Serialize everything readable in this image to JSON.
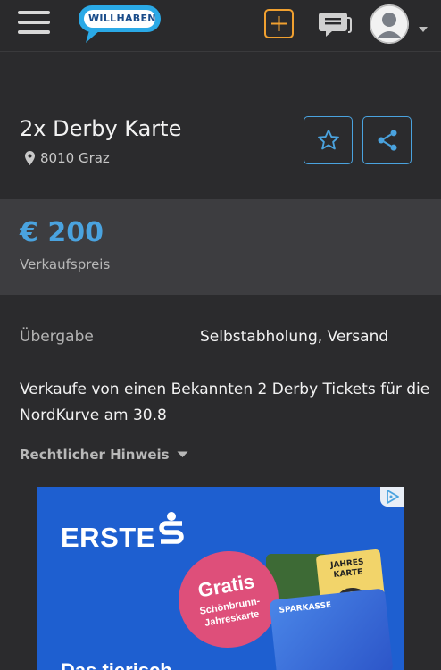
{
  "header": {
    "logo_text": "WILLHABEN",
    "icons": {
      "menu": "hamburger-menu-icon",
      "add": "plus-icon",
      "messages": "chat-bubbles-icon",
      "avatar": "user-avatar-icon",
      "caret": "chevron-down-icon"
    },
    "colors": {
      "add_accent": "#f0a030",
      "logo_blue": "#2aa9e6"
    }
  },
  "listing": {
    "title": "2x Derby Karte",
    "location": "8010 Graz",
    "price": "€ 200",
    "price_label": "Verkaufspreis",
    "detail_label": "Übergabe",
    "detail_value": "Selbstabholung, Versand",
    "description": "Verkaufe von einen Bekannten 2 Derby Tickets für die NordKurve am 30.8",
    "legal_link": "Rechtlicher Hinweis",
    "colors": {
      "price": "#4aa3df",
      "button_border": "#4aa3df"
    }
  },
  "ad": {
    "brand": "ERSTE",
    "badge_text": "Gratis",
    "badge_subtext": "Schönbrunn-Jahreskarte",
    "card_label": "JAHRES KARTE",
    "card_brand": "SPARKASSE",
    "bottom_text": "Das tierisch",
    "colors": {
      "background": "#1e5fd0",
      "badge": "#de4f7a"
    }
  }
}
